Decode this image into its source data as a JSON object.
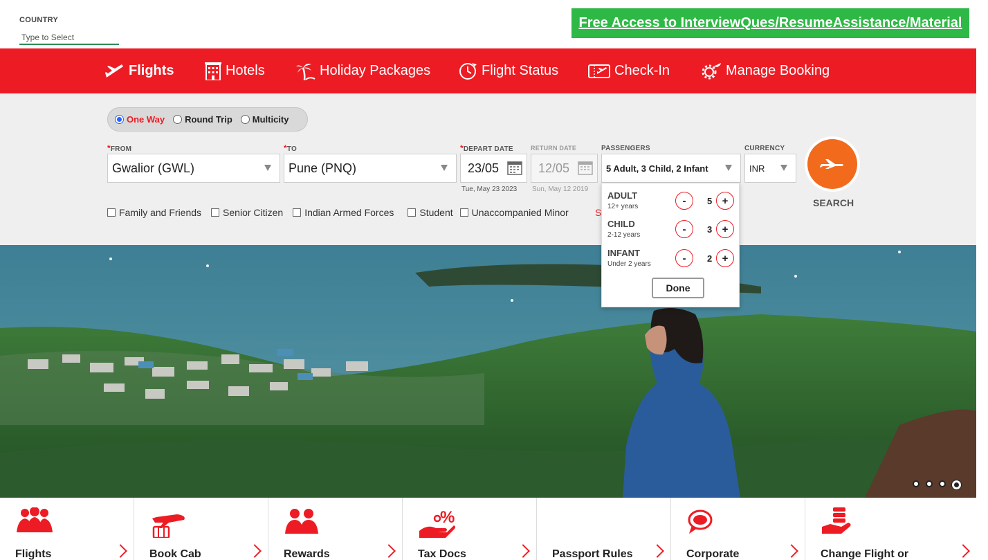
{
  "country": {
    "label": "COUNTRY",
    "placeholder": "Type to Select"
  },
  "promo": {
    "text": "Free Access to InterviewQues/ResumeAssistance/Material"
  },
  "nav": {
    "items": [
      {
        "label": "Flights",
        "icon": "plane-icon"
      },
      {
        "label": "Hotels",
        "icon": "hotel-icon"
      },
      {
        "label": "Holiday Packages",
        "icon": "palm-tree-icon"
      },
      {
        "label": "Flight Status",
        "icon": "clock-plane-icon"
      },
      {
        "label": "Check-In",
        "icon": "boarding-pass-icon"
      },
      {
        "label": "Manage Booking",
        "icon": "gear-plane-icon"
      }
    ]
  },
  "trip_type": {
    "options": [
      "One Way",
      "Round Trip",
      "Multicity"
    ],
    "selected": "One Way"
  },
  "from": {
    "label": "FROM",
    "value": "Gwalior (GWL)"
  },
  "to": {
    "label": "TO",
    "value": "Pune (PNQ)"
  },
  "depart": {
    "label": "DEPART DATE",
    "value": "23/05",
    "sub": "Tue, May 23 2023"
  },
  "return": {
    "label": "RETURN DATE",
    "value": "12/05",
    "sub": "Sun, May 12 2019"
  },
  "passengers": {
    "label": "PASSENGERS",
    "summary": "5 Adult, 3 Child, 2 Infant",
    "rows": [
      {
        "name": "ADULT",
        "age": "12+ years",
        "count": "5"
      },
      {
        "name": "CHILD",
        "age": "2-12 years",
        "count": "3"
      },
      {
        "name": "INFANT",
        "age": "Under 2 years",
        "count": "2"
      }
    ],
    "minus": "-",
    "plus": "+",
    "done": "Done"
  },
  "currency": {
    "label": "CURRENCY",
    "value": "INR"
  },
  "concessions": [
    "Family and Friends",
    "Senior Citizen",
    "Indian Armed Forces",
    "Student",
    "Unaccompanied Minor"
  ],
  "concession_peek": "S",
  "search": {
    "label": "SEARCH"
  },
  "carousel": {
    "count": 4,
    "active_index": 3
  },
  "tiles": [
    {
      "label": "Flights",
      "icon": "group-people-icon"
    },
    {
      "label": "Book Cab",
      "icon": "plane-luggage-icon"
    },
    {
      "label": "Rewards",
      "icon": "users-icon"
    },
    {
      "label": "Tax Docs",
      "icon": "hand-percent-icon"
    },
    {
      "label": "Passport Rules",
      "icon": ""
    },
    {
      "label": "Corporate",
      "icon": "chat-bubble-icon"
    },
    {
      "label": "Change Flight or",
      "icon": "hand-coins-icon"
    }
  ],
  "colors": {
    "brand_red": "#ed1c24",
    "promo_green": "#2eb845",
    "search_orange": "#f26b1d"
  }
}
